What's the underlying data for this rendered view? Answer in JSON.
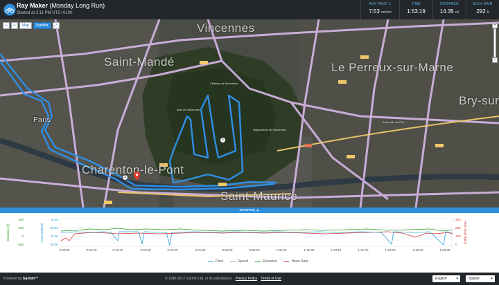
{
  "header": {
    "name": "Ray Maker",
    "activity": "(Monday Long Run)",
    "started": "Started at 3:11 PM UTC+0100",
    "stats": [
      {
        "label": "AVG PACE ⇕",
        "value": "7:53",
        "unit": "min/mi"
      },
      {
        "label": "TIME",
        "value": "1:53:19",
        "unit": ""
      },
      {
        "label": "DISTANCE",
        "value": "14.35",
        "unit": "mi"
      },
      {
        "label": "ELEV GAIN",
        "value": "292",
        "unit": "ft"
      }
    ]
  },
  "map": {
    "controls": {
      "back": "⇦",
      "forward": "⇨",
      "map": "Map",
      "satellite": "Satellite",
      "fullscreen": "⤢"
    },
    "zoom_in": "+",
    "zoom_out": "−",
    "labels": {
      "vincennes": "Vincennes",
      "saint_mande": "Saint-Mandé",
      "le_perreux": "Le Perreux-sur-Marne",
      "bry": "Bry-sur",
      "paris": "Paris",
      "charenton": "Charenton-le-Pont",
      "saint_maurice": "Saint-Maurice",
      "bois": "Bois de Vincennes",
      "hippodrome": "Hippodrome de Vincennes",
      "chateau": "Château de Vincennes",
      "autoroute": "Autoroute de l'Est"
    },
    "start_marker": "S",
    "finish_marker": "F",
    "colors": {
      "route": "#2f8fe6",
      "road": "#d7b7e8",
      "highway": "#f0c86a"
    }
  },
  "graphs": {
    "toggle_label": "GRAPHS ▲",
    "left_axis_1": {
      "title": "Elevation (ft)",
      "ticks": [
        "400",
        "200",
        "0",
        "-200"
      ],
      "color": "#2a9a2a"
    },
    "left_axis_2": {
      "title": "Pace (min/mi)",
      "ticks": [
        "16:59",
        "33:20",
        "25:00",
        "50:00"
      ],
      "color": "#2aa0d8"
    },
    "right_axis": {
      "title": "Heart Rate (bpm)",
      "ticks": [
        "300",
        "200",
        "100",
        "0"
      ],
      "color": "#d83030"
    },
    "x_ticks": [
      "0:00:00",
      "0:08:20",
      "0:16:40",
      "0:25:00",
      "0:33:20",
      "0:41:39",
      "0:50:00",
      "0:58:20",
      "1:06:40",
      "1:15:00",
      "1:23:19",
      "1:31:40",
      "1:40:00",
      "1:48:20",
      "1:56:39"
    ],
    "legend": [
      {
        "label": "Pace",
        "color": "#2aa0d8"
      },
      {
        "label": "Speed",
        "color": "#9aa4ad"
      },
      {
        "label": "Elevation",
        "color": "#2a9a2a"
      },
      {
        "label": "Heart Rate",
        "color": "#d83030"
      }
    ]
  },
  "footer": {
    "powered_prefix": "Powered by",
    "powered_brand": "Garmin™",
    "copyright": "© 1996-2012 Garmin Ltd. or its subsidiaries",
    "privacy": "Privacy Policy",
    "terms": "Terms of Use",
    "language": "English",
    "units": "Statute"
  }
}
